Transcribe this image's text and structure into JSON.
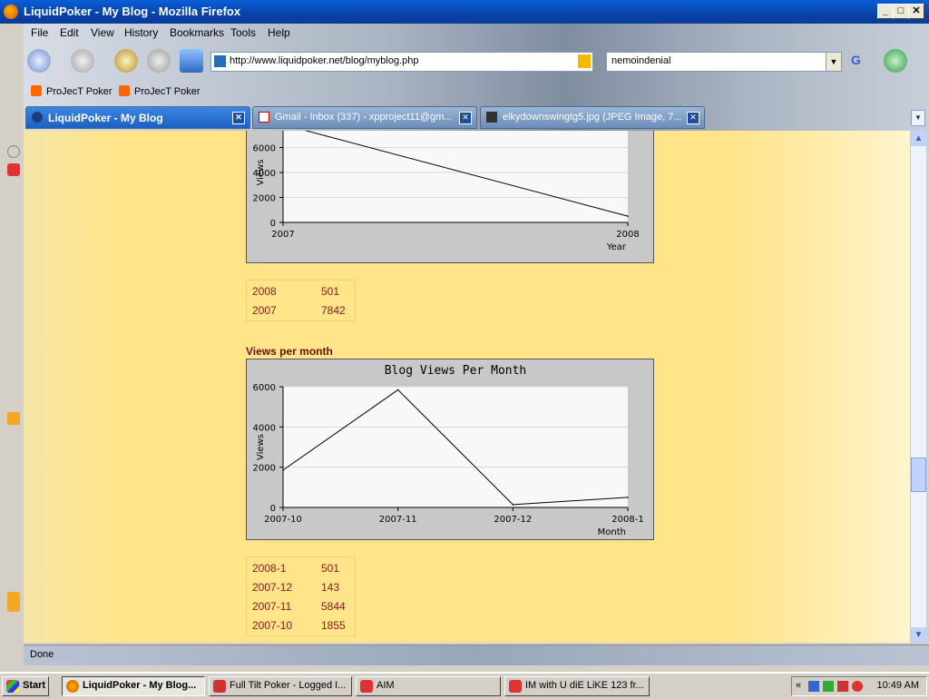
{
  "window": {
    "title": "LiquidPoker - My Blog - Mozilla Firefox"
  },
  "menu": [
    "File",
    "Edit",
    "View",
    "History",
    "Bookmarks",
    "Tools",
    "Help"
  ],
  "nav": {
    "url": "http://www.liquidpoker.net/blog/myblog.php",
    "search_value": "nemoindenial",
    "search_engine": "G"
  },
  "bookmarks": [
    "ProJecT Poker",
    "ProJecT Poker"
  ],
  "tabs": [
    {
      "label": "LiquidPoker - My Blog",
      "active": true
    },
    {
      "label": "Gmail - Inbox (337) - xpproject11@gm...",
      "active": false
    },
    {
      "label": "elkydownswingtg5.jpg (JPEG Image, 7...",
      "active": false
    }
  ],
  "yearly": {
    "rows": [
      {
        "period": "2008",
        "views": "501"
      },
      {
        "period": "2007",
        "views": "7842"
      }
    ]
  },
  "monthly": {
    "heading": "Views per month",
    "rows": [
      {
        "period": "2008-1",
        "views": "501"
      },
      {
        "period": "2007-12",
        "views": "143"
      },
      {
        "period": "2007-11",
        "views": "5844"
      },
      {
        "period": "2007-10",
        "views": "1855"
      }
    ]
  },
  "chart_data": [
    {
      "type": "line",
      "title": "",
      "xlabel": "Year",
      "ylabel": "Views",
      "categories": [
        "2007",
        "2008"
      ],
      "values": [
        7842,
        501
      ],
      "ylim": [
        0,
        8000
      ],
      "yticks": [
        "0",
        "2000",
        "4000",
        "6000"
      ],
      "grid": true
    },
    {
      "type": "line",
      "title": "Blog Views Per Month",
      "xlabel": "Month",
      "ylabel": "Views",
      "categories": [
        "2007-10",
        "2007-11",
        "2007-12",
        "2008-1"
      ],
      "values": [
        1855,
        5844,
        143,
        501
      ],
      "ylim": [
        0,
        6000
      ],
      "yticks": [
        "0",
        "2000",
        "4000",
        "6000"
      ],
      "grid": true
    }
  ],
  "status": {
    "text": "Done"
  },
  "taskbar": {
    "start": "Start",
    "items": [
      "LiquidPoker - My Blog...",
      "Full Tilt Poker - Logged I...",
      "AIM",
      "IM with U diE LiKE 123 fr..."
    ],
    "clock": "10:49 AM"
  }
}
